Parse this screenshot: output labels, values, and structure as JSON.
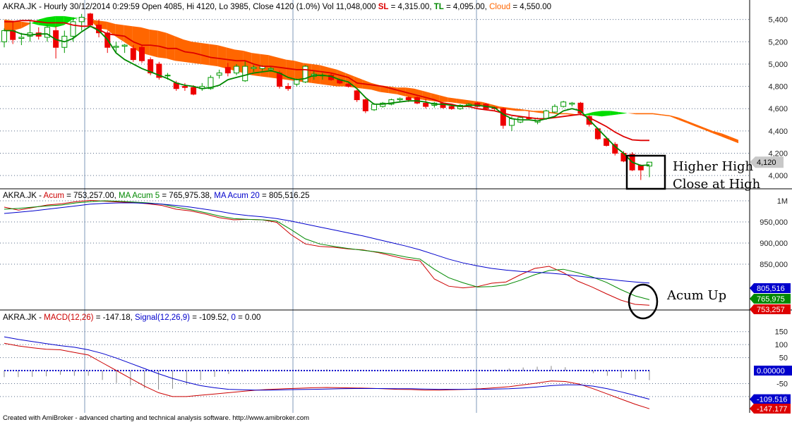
{
  "title_bar": {
    "symbol": "AKRA.JK",
    "info": "Hourly 30/12/2014 0:29:59 Open 4085, Hi 4120, Lo 3985, Close 4120 (1.0%) Vol 11,048,000",
    "sl_label": "SL",
    "sl_value": "= 4,315.00,",
    "tl_label": "TL",
    "tl_value": "= 4,095.00,",
    "cloud_label": "Cloud",
    "cloud_value": "= 4,550.00"
  },
  "acum_bar": {
    "symbol": "AKRA.JK",
    "acum_label": "Acum",
    "acum_value": "= 753,257.00,",
    "ma5_label": "MA Acum 5",
    "ma5_value": "= 765,975.38,",
    "ma20_label": "MA Acum 20",
    "ma20_value": "= 805,516.25"
  },
  "macd_bar": {
    "symbol": "AKRA.JK",
    "macd_label": "MACD(12,26)",
    "macd_value": "= -147.18,",
    "signal_label": "Signal(12,26,9)",
    "signal_value": "= -109.52,",
    "zero_label": "0",
    "zero_value": "= 0.00"
  },
  "annotations": {
    "higher_high": "Higher High",
    "close_at_high": "Close at High",
    "acum_up": "Acum Up"
  },
  "footer": "Created with AmiBroker - advanced charting and technical analysis software. http://www.amibroker.com",
  "colors": {
    "bull": "#00cc00",
    "bear": "#ee0000",
    "bull_candle_fill": "#ffffff",
    "bull_candle_edge": "#009900",
    "bear_candle": "#ee0000",
    "cloud_bear": "#ff6600",
    "cloud_bull": "#00dd00",
    "sl_line": "#dd0000",
    "tl_line": "#008800",
    "ma20": "#0000cc",
    "ma5": "#008800",
    "acum": "#cc0000",
    "grid": "#5a6d8a"
  },
  "chart_data": [
    {
      "type": "candlestick",
      "title": "AKRA.JK - Hourly",
      "y_ticks": [
        "5,400",
        "5,200",
        "5,000",
        "4,800",
        "4,600",
        "4,400",
        "4,200",
        "4,000"
      ],
      "ylim": [
        3900,
        5480
      ],
      "last_close_label": "4,120",
      "candles": [
        [
          5200,
          5320,
          5150,
          5300
        ],
        [
          5300,
          5380,
          5180,
          5220
        ],
        [
          5230,
          5280,
          5170,
          5240
        ],
        [
          5250,
          5400,
          5200,
          5280
        ],
        [
          5280,
          5330,
          5220,
          5250
        ],
        [
          5240,
          5350,
          5200,
          5330
        ],
        [
          5300,
          5340,
          5050,
          5150
        ],
        [
          5150,
          5300,
          5100,
          5250
        ],
        [
          5250,
          5420,
          5200,
          5380
        ],
        [
          5380,
          5450,
          5300,
          5420
        ],
        [
          5450,
          5460,
          5330,
          5350
        ],
        [
          5350,
          5400,
          5240,
          5280
        ],
        [
          5280,
          5300,
          5100,
          5150
        ],
        [
          5150,
          5200,
          5100,
          5160
        ],
        [
          5160,
          5180,
          5100,
          5170
        ],
        [
          5140,
          5170,
          5020,
          5040
        ],
        [
          5150,
          5170,
          5010,
          5030
        ],
        [
          5040,
          5060,
          4900,
          4920
        ],
        [
          5000,
          5020,
          4860,
          4880
        ],
        [
          4900,
          4920,
          4860,
          4900
        ],
        [
          4830,
          4850,
          4760,
          4780
        ],
        [
          4800,
          4830,
          4760,
          4790
        ],
        [
          4790,
          4810,
          4720,
          4730
        ],
        [
          4780,
          4830,
          4760,
          4800
        ],
        [
          4780,
          4900,
          4770,
          4880
        ],
        [
          4900,
          4950,
          4870,
          4920
        ],
        [
          4970,
          5010,
          4890,
          4920
        ],
        [
          4920,
          5000,
          4900,
          4980
        ],
        [
          4850,
          5030,
          4840,
          4980
        ],
        [
          4960,
          4990,
          4930,
          4970
        ],
        [
          4960,
          4990,
          4940,
          4980
        ],
        [
          4950,
          4980,
          4930,
          4960
        ],
        [
          4920,
          4940,
          4780,
          4800
        ],
        [
          4800,
          4830,
          4760,
          4780
        ],
        [
          4820,
          4870,
          4800,
          4860
        ],
        [
          4840,
          4990,
          4830,
          4980
        ],
        [
          4890,
          4940,
          4860,
          4910
        ],
        [
          4900,
          4920,
          4860,
          4900
        ],
        [
          4900,
          4920,
          4850,
          4860
        ],
        [
          4860,
          4870,
          4820,
          4830
        ],
        [
          4820,
          4830,
          4790,
          4800
        ],
        [
          4760,
          4770,
          4660,
          4680
        ],
        [
          4680,
          4690,
          4560,
          4580
        ],
        [
          4590,
          4650,
          4580,
          4640
        ],
        [
          4620,
          4660,
          4610,
          4650
        ],
        [
          4640,
          4690,
          4630,
          4680
        ],
        [
          4680,
          4700,
          4660,
          4690
        ],
        [
          4700,
          4710,
          4660,
          4680
        ],
        [
          4700,
          4710,
          4640,
          4650
        ],
        [
          4650,
          4690,
          4600,
          4620
        ],
        [
          4630,
          4660,
          4610,
          4650
        ],
        [
          4650,
          4660,
          4600,
          4610
        ],
        [
          4620,
          4630,
          4590,
          4600
        ],
        [
          4600,
          4640,
          4590,
          4630
        ],
        [
          4620,
          4650,
          4610,
          4640
        ],
        [
          4650,
          4660,
          4610,
          4620
        ],
        [
          4640,
          4650,
          4590,
          4600
        ],
        [
          4610,
          4620,
          4580,
          4600
        ],
        [
          4600,
          4610,
          4420,
          4450
        ],
        [
          4450,
          4530,
          4400,
          4510
        ],
        [
          4480,
          4530,
          4470,
          4520
        ],
        [
          4520,
          4580,
          4500,
          4510
        ],
        [
          4480,
          4520,
          4460,
          4510
        ],
        [
          4510,
          4590,
          4500,
          4580
        ],
        [
          4570,
          4640,
          4560,
          4620
        ],
        [
          4620,
          4670,
          4610,
          4660
        ],
        [
          4640,
          4660,
          4620,
          4650
        ],
        [
          4650,
          4660,
          4540,
          4560
        ],
        [
          4530,
          4540,
          4440,
          4460
        ],
        [
          4420,
          4430,
          4320,
          4330
        ],
        [
          4330,
          4340,
          4260,
          4270
        ],
        [
          4280,
          4300,
          4180,
          4200
        ],
        [
          4200,
          4220,
          4120,
          4130
        ],
        [
          4190,
          4210,
          4040,
          4050
        ],
        [
          4090,
          4100,
          3960,
          4050
        ],
        [
          4085,
          4120,
          3985,
          4120
        ]
      ],
      "tl_line": [
        5300,
        5300,
        5270,
        5260,
        5270,
        5270,
        5220,
        5200,
        5230,
        5290,
        5340,
        5300,
        5220,
        5100,
        5040,
        5000,
        4960,
        4930,
        4900,
        4870,
        4830,
        4810,
        4800,
        4780,
        4790,
        4810,
        4860,
        4880,
        4900,
        4920,
        4930,
        4940,
        4920,
        4880,
        4860,
        4870,
        4900,
        4900,
        4890,
        4860,
        4840,
        4780,
        4700,
        4640,
        4640,
        4650,
        4660,
        4670,
        4670,
        4660,
        4640,
        4640,
        4630,
        4620,
        4630,
        4630,
        4620,
        4610,
        4550,
        4510,
        4500,
        4500,
        4490,
        4510,
        4530,
        4580,
        4600,
        4580,
        4500,
        4420,
        4340,
        4260,
        4200,
        4120,
        4090,
        4095
      ],
      "sl_line": [
        5380,
        5380,
        5390,
        5390,
        5380,
        5370,
        5370,
        5370,
        5350,
        5340,
        5340,
        5310,
        5270,
        5260,
        5250,
        5200,
        5170,
        5170,
        5160,
        5140,
        5140,
        5110,
        5100,
        5080,
        5060,
        5050,
        5040,
        5030,
        5030,
        5000,
        4980,
        4980,
        4970,
        4960,
        4950,
        4950,
        4940,
        4930,
        4920,
        4900,
        4880,
        4830,
        4820,
        4810,
        4800,
        4780,
        4760,
        4740,
        4720,
        4700,
        4680,
        4650,
        4640,
        4620,
        4620,
        4600,
        4590,
        4580,
        4560,
        4540,
        4530,
        4520,
        4510,
        4510,
        4520,
        4530,
        4540,
        4550,
        4520,
        4480,
        4440,
        4390,
        4350,
        4320,
        4315,
        4315
      ],
      "cloud_top": [
        5400,
        5390,
        5380,
        5370,
        5350,
        5340,
        5330,
        5350,
        5400,
        5420,
        5400,
        5390,
        5380,
        5360,
        5350,
        5340,
        5330,
        5310,
        5300,
        5280,
        5250,
        5220,
        5200,
        5190,
        5180,
        5170,
        5150,
        5130,
        5120,
        5100,
        5090,
        5080,
        5060,
        5040,
        5030,
        5010,
        5000,
        4990,
        4970,
        4950,
        4920,
        4890,
        4860,
        4830,
        4810,
        4800,
        4790,
        4790,
        4780,
        4760,
        4740,
        4720,
        4700,
        4690,
        4680,
        4670,
        4660,
        4640,
        4620,
        4610,
        4600,
        4590,
        4580,
        4580,
        4570,
        4560,
        4560,
        4550,
        4540,
        4540,
        4530,
        4540,
        4550,
        4560,
        4560,
        4560,
        4560,
        4550,
        4540,
        4520,
        4490,
        4460,
        4430,
        4400,
        4380,
        4350,
        4320
      ],
      "cloud_bottom": [
        5300,
        5300,
        5320,
        5360,
        5400,
        5420,
        5430,
        5430,
        5420,
        5410,
        5400,
        5320,
        5310,
        5250,
        5200,
        5150,
        5100,
        5080,
        5060,
        5050,
        5030,
        5020,
        5010,
        5000,
        4990,
        4980,
        4960,
        4940,
        4920,
        4900,
        4890,
        4880,
        4870,
        4860,
        4850,
        4840,
        4830,
        4820,
        4810,
        4800,
        4800,
        4790,
        4780,
        4770,
        4750,
        4740,
        4730,
        4710,
        4690,
        4680,
        4670,
        4660,
        4660,
        4650,
        4640,
        4630,
        4620,
        4610,
        4600,
        4590,
        4580,
        4580,
        4570,
        4560,
        4560,
        4550,
        4550,
        4540,
        4550,
        4570,
        4580,
        4580,
        4570,
        4560,
        4550,
        4550,
        4550,
        4540,
        4530,
        4500,
        4470,
        4440,
        4410,
        4380,
        4350,
        4320,
        4290
      ]
    },
    {
      "type": "line",
      "title": "AKRA.JK - Acum",
      "y_ticks": [
        "1M",
        "950,000",
        "900,000",
        "850,000"
      ],
      "ylim": [
        745000,
        1005000
      ],
      "series": [
        {
          "name": "Acum",
          "badge": "753,257",
          "values": [
            985000,
            978000,
            984000,
            990000,
            993000,
            998000,
            1001000,
            999000,
            997000,
            996000,
            993000,
            989000,
            980000,
            976000,
            969000,
            960000,
            955000,
            956000,
            955000,
            949000,
            920000,
            898000,
            892000,
            890000,
            886000,
            884000,
            878000,
            870000,
            862000,
            858000,
            815000,
            798000,
            794000,
            797000,
            805000,
            808000,
            825000,
            840000,
            845000,
            830000,
            810000,
            796000,
            780000,
            765000,
            755000,
            753000
          ]
        },
        {
          "name": "MA Acum 5",
          "badge": "765,975",
          "values": [
            980000,
            982000,
            985000,
            988000,
            990000,
            995000,
            998000,
            1000000,
            999000,
            997000,
            995000,
            992000,
            985000,
            979000,
            972000,
            964000,
            958000,
            956000,
            955000,
            952000,
            932000,
            910000,
            898000,
            892000,
            887000,
            883000,
            879000,
            874000,
            867000,
            862000,
            838000,
            818000,
            806000,
            796000,
            797000,
            801000,
            812000,
            825000,
            835000,
            838000,
            830000,
            820000,
            807000,
            790000,
            775000,
            766000
          ]
        },
        {
          "name": "MA Acum 20",
          "badge": "805,516",
          "values": [
            970000,
            973000,
            976000,
            980000,
            984000,
            988000,
            992000,
            994000,
            995000,
            995000,
            994000,
            992000,
            989000,
            985000,
            980000,
            975000,
            969000,
            965000,
            962000,
            958000,
            952000,
            945000,
            938000,
            931000,
            924000,
            917000,
            909000,
            901000,
            893000,
            884000,
            873000,
            862000,
            853000,
            846000,
            840000,
            836000,
            833000,
            831000,
            829000,
            826000,
            822000,
            818000,
            815000,
            811000,
            808000,
            805500
          ]
        }
      ]
    },
    {
      "type": "line",
      "title": "AKRA.JK - MACD(12,26)",
      "y_ticks": [
        "150",
        "100",
        "50",
        "-50",
        "-100"
      ],
      "ylim": [
        -160,
        190
      ],
      "zero_badge": "0.00000",
      "series": [
        {
          "name": "MACD(12,26)",
          "badge": "-147.177",
          "values": [
            105,
            95,
            88,
            82,
            80,
            70,
            60,
            30,
            0,
            -30,
            -60,
            -85,
            -100,
            -100,
            -95,
            -90,
            -85,
            -80,
            -75,
            -72,
            -70,
            -68,
            -66,
            -65,
            -66,
            -67,
            -68,
            -70,
            -72,
            -73,
            -75,
            -75,
            -74,
            -72,
            -70,
            -66,
            -62,
            -55,
            -48,
            -40,
            -42,
            -52,
            -70,
            -90,
            -110,
            -130,
            -147
          ]
        },
        {
          "name": "Signal(12,26,9)",
          "badge": "-109.516",
          "values": [
            130,
            120,
            112,
            104,
            96,
            90,
            80,
            66,
            48,
            28,
            8,
            -12,
            -30,
            -45,
            -58,
            -66,
            -72,
            -74,
            -75,
            -75,
            -74,
            -73,
            -72,
            -71,
            -70,
            -69,
            -69,
            -69,
            -70,
            -70,
            -71,
            -72,
            -72,
            -72,
            -72,
            -71,
            -70,
            -67,
            -63,
            -58,
            -55,
            -55,
            -60,
            -70,
            -82,
            -96,
            -110
          ]
        }
      ],
      "histogram": [
        -25,
        -25,
        -24,
        -22,
        -16,
        -20,
        -20,
        -36,
        -48,
        -58,
        -68,
        -73,
        -70,
        -55,
        -37,
        -24,
        -13,
        -6,
        0,
        3,
        4,
        5,
        6,
        6,
        4,
        2,
        1,
        -1,
        -2,
        -3,
        -4,
        -3,
        -2,
        0,
        2,
        5,
        8,
        12,
        15,
        18,
        13,
        3,
        -10,
        -20,
        -28,
        -34,
        -37
      ]
    }
  ]
}
